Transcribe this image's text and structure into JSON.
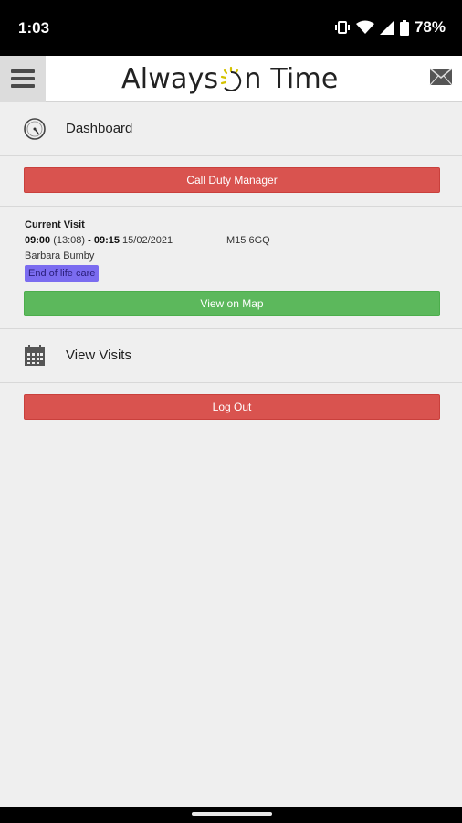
{
  "status_bar": {
    "time": "1:03",
    "battery_percent": "78%"
  },
  "header": {
    "logo_before": "Always ",
    "logo_after": "n Time"
  },
  "nav": {
    "dashboard_label": "Dashboard",
    "view_visits_label": "View Visits"
  },
  "actions": {
    "call_duty_manager": "Call Duty Manager",
    "view_on_map": "View on Map",
    "log_out": "Log Out"
  },
  "current_visit": {
    "title": "Current Visit",
    "start": "09:00",
    "actual": "(13:08)",
    "sep": " - ",
    "end": "09:15",
    "date": "15/02/2021",
    "postcode": "M15 6GQ",
    "client": "Barbara Bumby",
    "tag": "End of life care"
  },
  "colors": {
    "danger": "#d9534f",
    "success": "#5cb85c",
    "tag": "#7b6cf0"
  }
}
